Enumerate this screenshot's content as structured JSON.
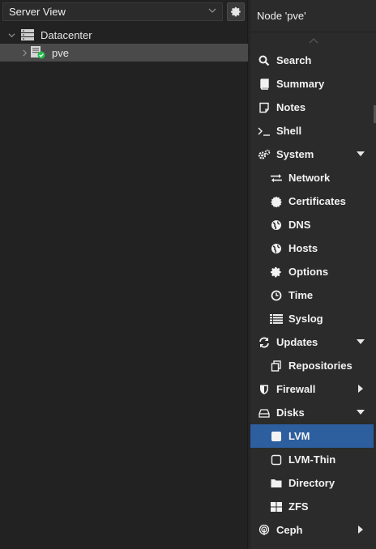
{
  "left": {
    "view_select": "Server View",
    "tree": [
      {
        "label": "Datacenter"
      },
      {
        "label": "pve"
      }
    ]
  },
  "right": {
    "header": "Node 'pve'",
    "items": [
      {
        "label": "Search",
        "icon": "search-icon"
      },
      {
        "label": "Summary",
        "icon": "book-icon"
      },
      {
        "label": "Notes",
        "icon": "note-icon"
      },
      {
        "label": "Shell",
        "icon": "terminal-icon"
      },
      {
        "label": "System",
        "icon": "cogs-icon"
      },
      {
        "label": "Network",
        "icon": "exchange-icon"
      },
      {
        "label": "Certificates",
        "icon": "certificate-icon"
      },
      {
        "label": "DNS",
        "icon": "globe-icon"
      },
      {
        "label": "Hosts",
        "icon": "globe-icon"
      },
      {
        "label": "Options",
        "icon": "gear-icon"
      },
      {
        "label": "Time",
        "icon": "clock-icon"
      },
      {
        "label": "Syslog",
        "icon": "list-icon"
      },
      {
        "label": "Updates",
        "icon": "refresh-icon"
      },
      {
        "label": "Repositories",
        "icon": "files-icon"
      },
      {
        "label": "Firewall",
        "icon": "shield-icon"
      },
      {
        "label": "Disks",
        "icon": "hdd-icon"
      },
      {
        "label": "LVM",
        "icon": "square-icon"
      },
      {
        "label": "LVM-Thin",
        "icon": "square-outline-icon"
      },
      {
        "label": "Directory",
        "icon": "folder-icon"
      },
      {
        "label": "ZFS",
        "icon": "grid-icon"
      },
      {
        "label": "Ceph",
        "icon": "ceph-icon"
      }
    ]
  },
  "colors": {
    "accent": "#2d5e9e",
    "selected_tree": "#4a4a4a",
    "status_ok": "#21bf4b"
  }
}
